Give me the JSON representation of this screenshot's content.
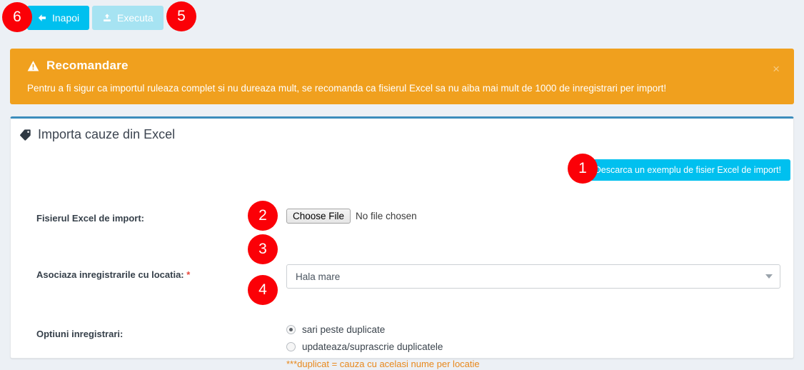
{
  "toolbar": {
    "back_label": "Inapoi",
    "back_icon": "arrow-left-icon",
    "execute_label": "Executa",
    "execute_icon": "upload-icon"
  },
  "alert": {
    "icon": "warning-triangle-icon",
    "title": "Recomandare",
    "message": "Pentru a fi sigur ca importul ruleaza complet si nu dureaza mult, se recomanda ca fisierul Excel sa nu aiba mai mult de 1000 de inregistrari per import!",
    "close_label": "×",
    "background": "#f0a01e"
  },
  "panel": {
    "icon": "tag-icon",
    "title": "Importa cauze din Excel",
    "download_button_label": "Descarca un exemplu de fisier Excel de import!",
    "accent_color": "#3c8dbc",
    "button_color": "#00c0ef"
  },
  "form": {
    "file_row": {
      "label": "Fisierul Excel de import:",
      "choose_label": "Choose File",
      "no_file_text": "No file chosen"
    },
    "location_row": {
      "label": "Asociaza inregistrarile cu locatia:",
      "required_marker": "*",
      "selected_value": "Hala mare",
      "caret_icon": "chevron-down-icon"
    },
    "options_row": {
      "label": "Optiuni inregistrari:",
      "options": [
        {
          "label": "sari peste duplicate",
          "checked": true
        },
        {
          "label": "updateaza/suprascrie duplicatele",
          "checked": false
        }
      ],
      "note": "***duplicat = cauza cu acelasi nume per locatie",
      "note_color": "#e8881c"
    }
  },
  "badges": [
    {
      "number": "1"
    },
    {
      "number": "2"
    },
    {
      "number": "3"
    },
    {
      "number": "4"
    },
    {
      "number": "5"
    },
    {
      "number": "6"
    }
  ]
}
